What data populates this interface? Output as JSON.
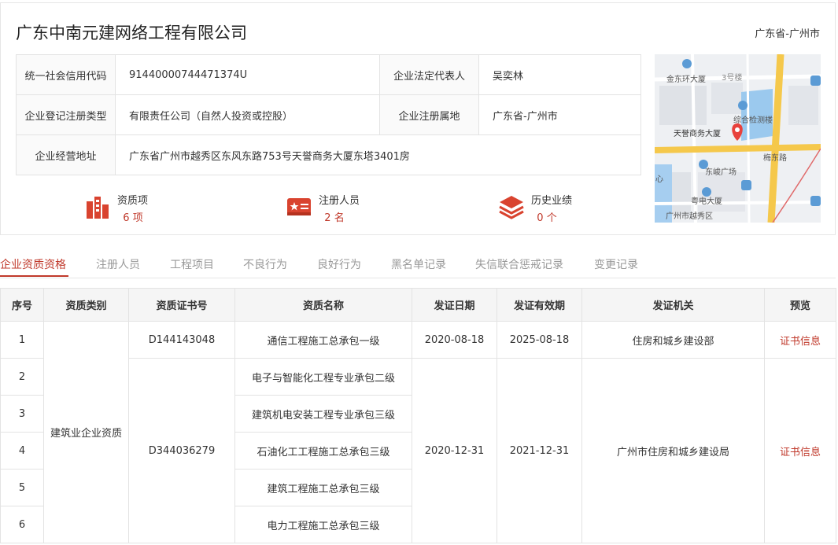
{
  "company": {
    "name": "广东中南元建网络工程有限公司",
    "region": "广东省-广州市"
  },
  "info": {
    "credit_code_label": "统一社会信用代码",
    "credit_code": "91440000744471374U",
    "legal_rep_label": "企业法定代表人",
    "legal_rep": "吴奕林",
    "reg_type_label": "企业登记注册类型",
    "reg_type": "有限责任公司（自然人投资或控股）",
    "reg_place_label": "企业注册属地",
    "reg_place": "广东省-广州市",
    "address_label": "企业经营地址",
    "address": "广东省广州市越秀区东风东路753号天誉商务大厦东塔3401房"
  },
  "map": {
    "labels": {
      "jinhuan": "金东环大厦",
      "bldg3": "3号楼",
      "zonghe": "综合检测楼",
      "tianyu": "天誉商务大厦",
      "meidong": "梅东路",
      "dongjun": "东峻广场",
      "yuedian": "粤电大厦",
      "yuexiu": "广州市越秀区",
      "xin": "心"
    },
    "colors": {
      "road_major": "#f5c84b",
      "road_minor": "#ffffff",
      "water": "#a6cef0",
      "park": "#9bc9ee",
      "pin": "#e8413c",
      "block": "#dfe2e7",
      "poi": "#5b9bd5"
    }
  },
  "stats": [
    {
      "label": "资质项",
      "value": "6 项",
      "icon": "building-chart-icon"
    },
    {
      "label": "注册人员",
      "value": "2 名",
      "icon": "certificate-card-icon"
    },
    {
      "label": "历史业绩",
      "value": "0 个",
      "icon": "layers-stack-icon"
    }
  ],
  "tabs": [
    "企业资质资格",
    "注册人员",
    "工程项目",
    "不良行为",
    "良好行为",
    "黑名单记录",
    "失信联合惩戒记录",
    "变更记录"
  ],
  "table": {
    "headers": [
      "序号",
      "资质类别",
      "资质证书号",
      "资质名称",
      "发证日期",
      "发证有效期",
      "发证机关",
      "预览"
    ],
    "category": "建筑业企业资质",
    "rows": [
      {
        "no": "1",
        "cert_no": "D144143048",
        "name": "通信工程施工总承包一级",
        "issue_date": "2020-08-18",
        "valid_until": "2025-08-18",
        "authority": "住房和城乡建设部",
        "preview": "证书信息"
      },
      {
        "no": "2",
        "name": "电子与智能化工程专业承包二级"
      },
      {
        "no": "3",
        "name": "建筑机电安装工程专业承包三级"
      },
      {
        "no": "4",
        "cert_no": "D344036279",
        "name": "石油化工工程施工总承包三级",
        "issue_date": "2020-12-31",
        "valid_until": "2021-12-31",
        "authority": "广州市住房和城乡建设局",
        "preview": "证书信息"
      },
      {
        "no": "5",
        "name": "建筑工程施工总承包三级"
      },
      {
        "no": "6",
        "name": "电力工程施工总承包三级"
      }
    ]
  },
  "colors": {
    "accent": "#c0392b",
    "border": "#e3e3e3",
    "header_bg": "#f5f5f5"
  }
}
